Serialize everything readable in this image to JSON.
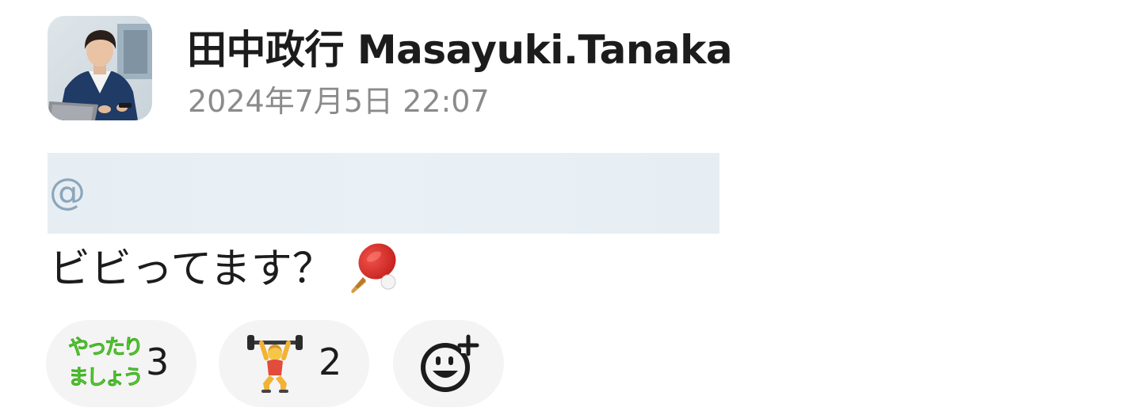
{
  "message": {
    "sender_name": "田中政行 Masayuki.Tanaka",
    "timestamp": "2024年7月5日 22:07",
    "mention_prefix": "@",
    "text": "ビビってます？",
    "inline_emoji": "ping-pong-paddle-icon"
  },
  "reactions": [
    {
      "emoji": "custom-yattari-mashou-emoji",
      "emoji_line_1": "やったり",
      "emoji_line_2": "ましょう",
      "count": "3"
    },
    {
      "emoji": "weightlifter-emoji",
      "count": "2"
    }
  ],
  "add_reaction": {
    "icon": "add-reaction-icon"
  },
  "colors": {
    "name": "#1d1c1d",
    "timestamp": "#8b8b8b",
    "reaction_bg": "#f4f4f4",
    "mention_bg": "#e6eef4",
    "custom_emoji_green": "#6fe04a"
  }
}
